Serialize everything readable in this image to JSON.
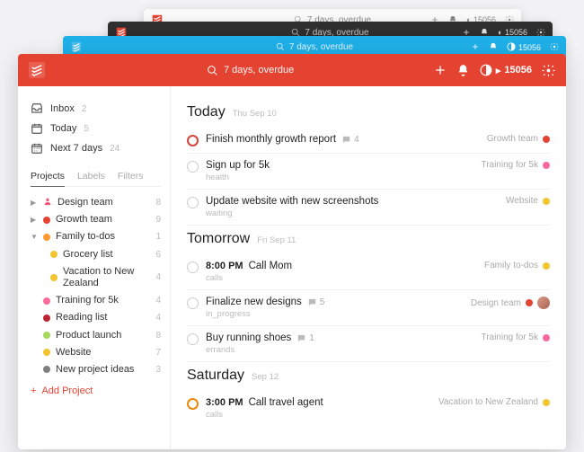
{
  "search_placeholder": "7 days, overdue",
  "karma_points": "15056",
  "colors": {
    "red": "#e44332",
    "orange": "#ff9933",
    "yellow": "#f4c430",
    "pink": "#ff6b9d",
    "darkred": "#b8252f",
    "lime": "#a6d85c",
    "grey": "#808080"
  },
  "nav": [
    {
      "key": "inbox",
      "label": "Inbox",
      "count": "2"
    },
    {
      "key": "today",
      "label": "Today",
      "count": "5"
    },
    {
      "key": "next7",
      "label": "Next 7 days",
      "count": "24"
    }
  ],
  "tabs": {
    "projects": "Projects",
    "labels": "Labels",
    "filters": "Filters"
  },
  "projects": [
    {
      "name": "Design team",
      "count": "8",
      "color": "person",
      "arrow": "▶"
    },
    {
      "name": "Growth team",
      "count": "9",
      "color": "red",
      "arrow": "▶"
    },
    {
      "name": "Family to-dos",
      "count": "1",
      "color": "orange",
      "arrow": "▼",
      "children": [
        {
          "name": "Grocery list",
          "count": "6",
          "color": "yellow"
        },
        {
          "name": "Vacation to New Zealand",
          "count": "4",
          "color": "yellow"
        }
      ]
    },
    {
      "name": "Training for 5k",
      "count": "4",
      "color": "pink"
    },
    {
      "name": "Reading list",
      "count": "4",
      "color": "darkred"
    },
    {
      "name": "Product launch",
      "count": "8",
      "color": "lime"
    },
    {
      "name": "Website",
      "count": "7",
      "color": "yellow"
    },
    {
      "name": "New project ideas",
      "count": "3",
      "color": "grey"
    }
  ],
  "add_project_label": "Add Project",
  "sections": [
    {
      "title": "Today",
      "date": "Thu Sep 10",
      "tasks": [
        {
          "priority": "p1",
          "text": "Finish monthly growth report",
          "comments": "4",
          "project": "Growth team",
          "pcolor": "red"
        },
        {
          "priority": "",
          "text": "Sign up for 5k",
          "sub": "health",
          "project": "Training for 5k",
          "pcolor": "pink"
        },
        {
          "priority": "",
          "text": "Update website with new screenshots",
          "sub": "waiting",
          "project": "Website",
          "pcolor": "yellow"
        }
      ]
    },
    {
      "title": "Tomorrow",
      "date": "Fri Sep 11",
      "tasks": [
        {
          "priority": "",
          "time": "8:00 PM",
          "text": "Call Mom",
          "sub": "calls",
          "project": "Family to-dos",
          "pcolor": "yellow"
        },
        {
          "priority": "",
          "text": "Finalize new designs",
          "comments": "5",
          "sub": "in_progress",
          "project": "Design team",
          "pcolor": "red",
          "avatar": true
        },
        {
          "priority": "",
          "text": "Buy running shoes",
          "comments": "1",
          "sub": "errands",
          "project": "Training for 5k",
          "pcolor": "pink"
        }
      ]
    },
    {
      "title": "Saturday",
      "date": "Sep 12",
      "tasks": [
        {
          "priority": "p2",
          "time": "3:00 PM",
          "text": "Call travel agent",
          "sub": "calls",
          "project": "Vacation to New Zealand",
          "pcolor": "yellow"
        }
      ]
    }
  ]
}
